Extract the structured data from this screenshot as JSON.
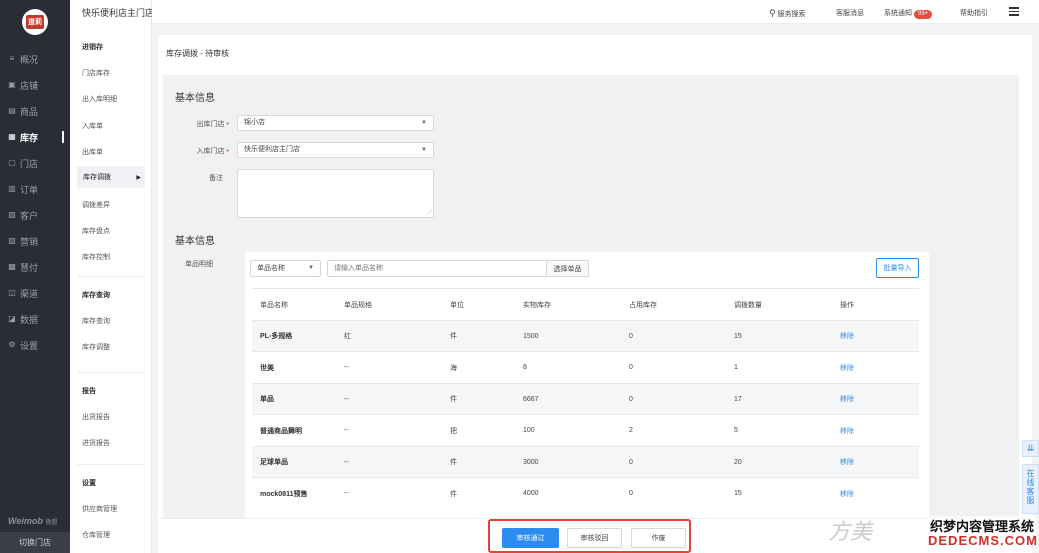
{
  "nav": {
    "logo_text": "道莉",
    "items": [
      {
        "label": "概况",
        "icon": "≡"
      },
      {
        "label": "店铺",
        "icon": "▣"
      },
      {
        "label": "商品",
        "icon": "▤"
      },
      {
        "label": "库存",
        "icon": "▦"
      },
      {
        "label": "门店",
        "icon": "▢"
      },
      {
        "label": "订单",
        "icon": "▥"
      },
      {
        "label": "客户",
        "icon": "▧"
      },
      {
        "label": "营销",
        "icon": "▨"
      },
      {
        "label": "慧付",
        "icon": "▩"
      },
      {
        "label": "渠道",
        "icon": "◫"
      },
      {
        "label": "数据",
        "icon": "◪"
      },
      {
        "label": "设置",
        "icon": "⚙"
      }
    ],
    "active_index": 3,
    "brand": "Weimob",
    "brand_sub": "微盟",
    "switch_store": "切换门店"
  },
  "sub": {
    "store_title": "快乐便利店主门店",
    "groups": [
      {
        "title": "进销存",
        "items": [
          "门店库存",
          "出入库明细",
          "入库单",
          "出库单",
          "库存调拨",
          "调拨差异",
          "库存盘点",
          "库存控制"
        ]
      },
      {
        "title": "库存查询",
        "items": [
          "库存查询",
          "库存调整"
        ]
      },
      {
        "title": "报告",
        "items": [
          "出货报告",
          "进货报告"
        ]
      },
      {
        "title": "设置",
        "items": [
          "供应商管理",
          "仓库管理"
        ]
      }
    ],
    "active_item": "库存调拨"
  },
  "header": {
    "search": "服务搜索",
    "service": "客服消息",
    "notify": "系统通知",
    "notify_badge": "99+",
    "help": "帮助指引"
  },
  "page": {
    "breadcrumb": "库存调拨 - 待审核",
    "section1": "基本信息",
    "out_store_label": "出库门店",
    "out_store_value": "锦小店",
    "in_store_label": "入库门店",
    "in_store_value": "快乐便利店主门店",
    "remark_label": "备注",
    "section2": "基本信息",
    "goods_label": "单品明细",
    "filter_select": "单品名称",
    "filter_placeholder": "请输入单品名称",
    "select_button": "选择单品",
    "import_button": "批量导入"
  },
  "table": {
    "columns": [
      "单品名称",
      "单品规格",
      "单位",
      "实物库存",
      "占用库存",
      "调拨数量",
      "操作"
    ],
    "rows": [
      [
        "PL-多规格",
        "红",
        "件",
        "1500",
        "0",
        "15",
        "移除"
      ],
      [
        "世美",
        "--",
        "海",
        "8",
        "0",
        "1",
        "移除"
      ],
      [
        "单品",
        "--",
        "件",
        "6667",
        "0",
        "17",
        "移除"
      ],
      [
        "普通商品舞明",
        "--",
        "把",
        "100",
        "2",
        "5",
        "移除"
      ],
      [
        "足球单品",
        "--",
        "件",
        "3000",
        "0",
        "20",
        "移除"
      ],
      [
        "mock0811预售",
        "--",
        "件",
        "4000",
        "0",
        "15",
        "移除"
      ]
    ]
  },
  "footer": {
    "approve": "审核通过",
    "reject": "审核驳回",
    "void": "作废"
  },
  "float": {
    "download_icon": "⇊",
    "online": "在线客服"
  },
  "watermark": {
    "w1": "方美",
    "w2": "织梦内容管理系统",
    "w3": "DEDECMS.COM"
  },
  "colors": {
    "nav_bg": "#2a2d35",
    "primary": "#2d8cf0",
    "highlight": "#e0453a",
    "badge": "#e74c3c"
  }
}
